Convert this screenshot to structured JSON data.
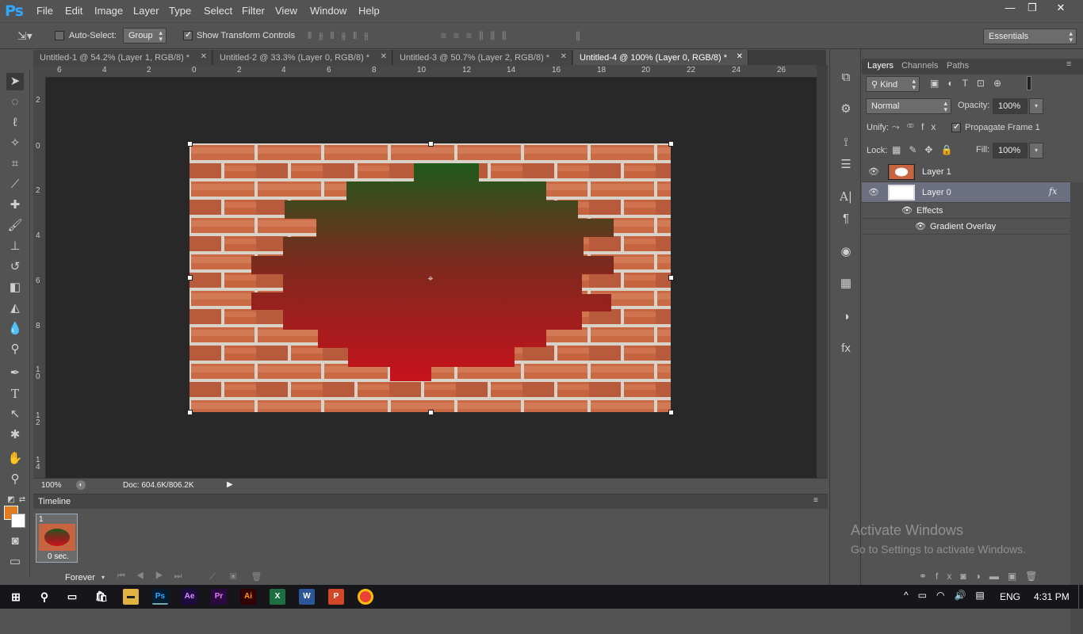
{
  "app": {
    "logo": "Ps",
    "menu": [
      "File",
      "Edit",
      "Image",
      "Layer",
      "Type",
      "Select",
      "Filter",
      "View",
      "Window",
      "Help"
    ],
    "window_controls": [
      "—",
      "❐",
      "✕"
    ]
  },
  "options": {
    "auto_select_label": "Auto-Select:",
    "auto_select_checked": false,
    "auto_select_value": "Group",
    "transform_controls_label": "Show Transform Controls",
    "transform_controls_checked": true,
    "workspace_value": "Essentials"
  },
  "tabs": [
    {
      "label": "Untitled-1 @ 54.2% (Layer 1, RGB/8) *",
      "active": false
    },
    {
      "label": "Untitled-2 @ 33.3% (Layer 0, RGB/8) *",
      "active": false
    },
    {
      "label": "Untitled-3 @ 50.7% (Layer 2, RGB/8) *",
      "active": false
    },
    {
      "label": "Untitled-4 @ 100% (Layer 0, RGB/8) *",
      "active": true
    }
  ],
  "rulers": {
    "horizontal": [
      "6",
      "4",
      "2",
      "0",
      "2",
      "4",
      "6",
      "8",
      "10",
      "12",
      "14",
      "16",
      "18",
      "20",
      "22",
      "24",
      "26"
    ],
    "vertical": [
      "2",
      "0",
      "2",
      "4",
      "6",
      "8",
      "1 0",
      "1 2",
      "1 4"
    ]
  },
  "status": {
    "zoom": "100%",
    "doc": "Doc: 604.6K/806.2K"
  },
  "timeline": {
    "title": "Timeline",
    "frame_number": "1",
    "frame_delay": "0 sec.",
    "loop": "Forever"
  },
  "colors": {
    "foreground": "#e37c1f",
    "background": "#ffffff",
    "accent": "#31a8ff",
    "brick": "#c8643f",
    "gradient_top": "#1f5a1c",
    "gradient_bottom": "#c8121c"
  },
  "layers_panel": {
    "tabs": [
      "Layers",
      "Channels",
      "Paths"
    ],
    "filter_kind": "Kind",
    "blend_mode": "Normal",
    "opacity_label": "Opacity:",
    "opacity_value": "100%",
    "unify_label": "Unify:",
    "propagate_label": "Propagate Frame 1",
    "propagate_checked": true,
    "lock_label": "Lock:",
    "fill_label": "Fill:",
    "fill_value": "100%",
    "layers": [
      {
        "name": "Layer 1",
        "visible": true,
        "selected": false
      },
      {
        "name": "Layer 0",
        "visible": true,
        "selected": true,
        "has_fx": true,
        "fx_label": "fx"
      }
    ],
    "effects_label": "Effects",
    "effect_items": [
      "Gradient Overlay"
    ]
  },
  "watermark": {
    "line1": "Activate Windows",
    "line2": "Go to Settings to activate Windows."
  },
  "taskbar": {
    "language": "ENG",
    "time": "4:31 PM",
    "apps": [
      "Ps",
      "Ae",
      "Pr",
      "Ai",
      "X",
      "W",
      "P"
    ]
  }
}
